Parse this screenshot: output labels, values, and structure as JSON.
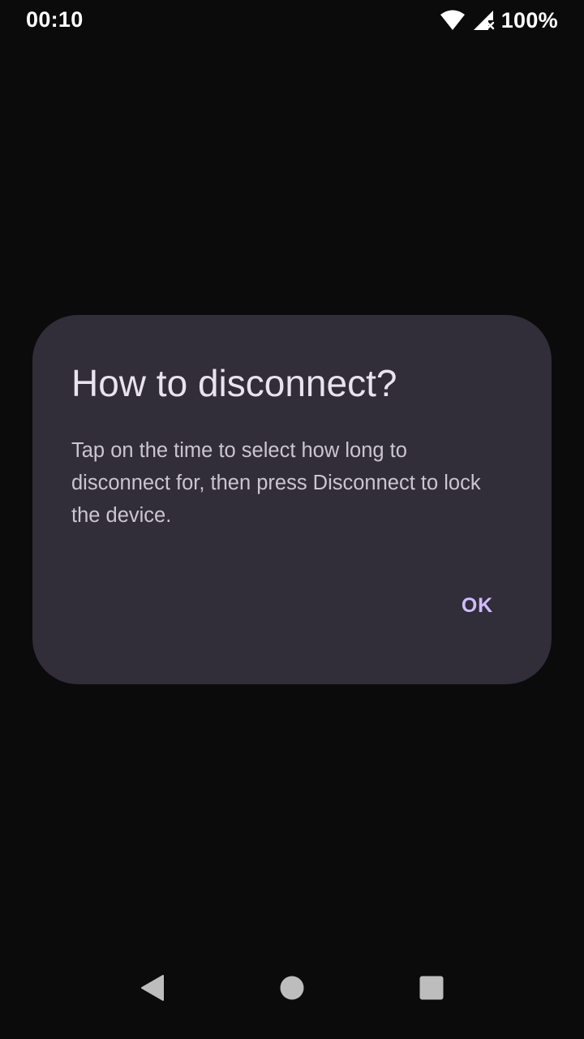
{
  "status_bar": {
    "time": "00:10",
    "battery": "100%"
  },
  "dialog": {
    "title": "How to disconnect?",
    "message": "Tap on the time to select how long to disconnect for, then press Disconnect to lock the device.",
    "ok_label": "OK"
  },
  "icons": {
    "wifi": "wifi-icon",
    "signal": "cell-signal-no-data-icon",
    "back": "back-triangle-icon",
    "home": "home-circle-icon",
    "recents": "recents-square-icon"
  },
  "colors": {
    "background": "#0b0b0c",
    "dialog_surface": "#312d39",
    "title_text": "#e8e3ee",
    "body_text": "#cbc5d2",
    "accent": "#cfbcff",
    "nav_icons": "#bdbdbd"
  }
}
